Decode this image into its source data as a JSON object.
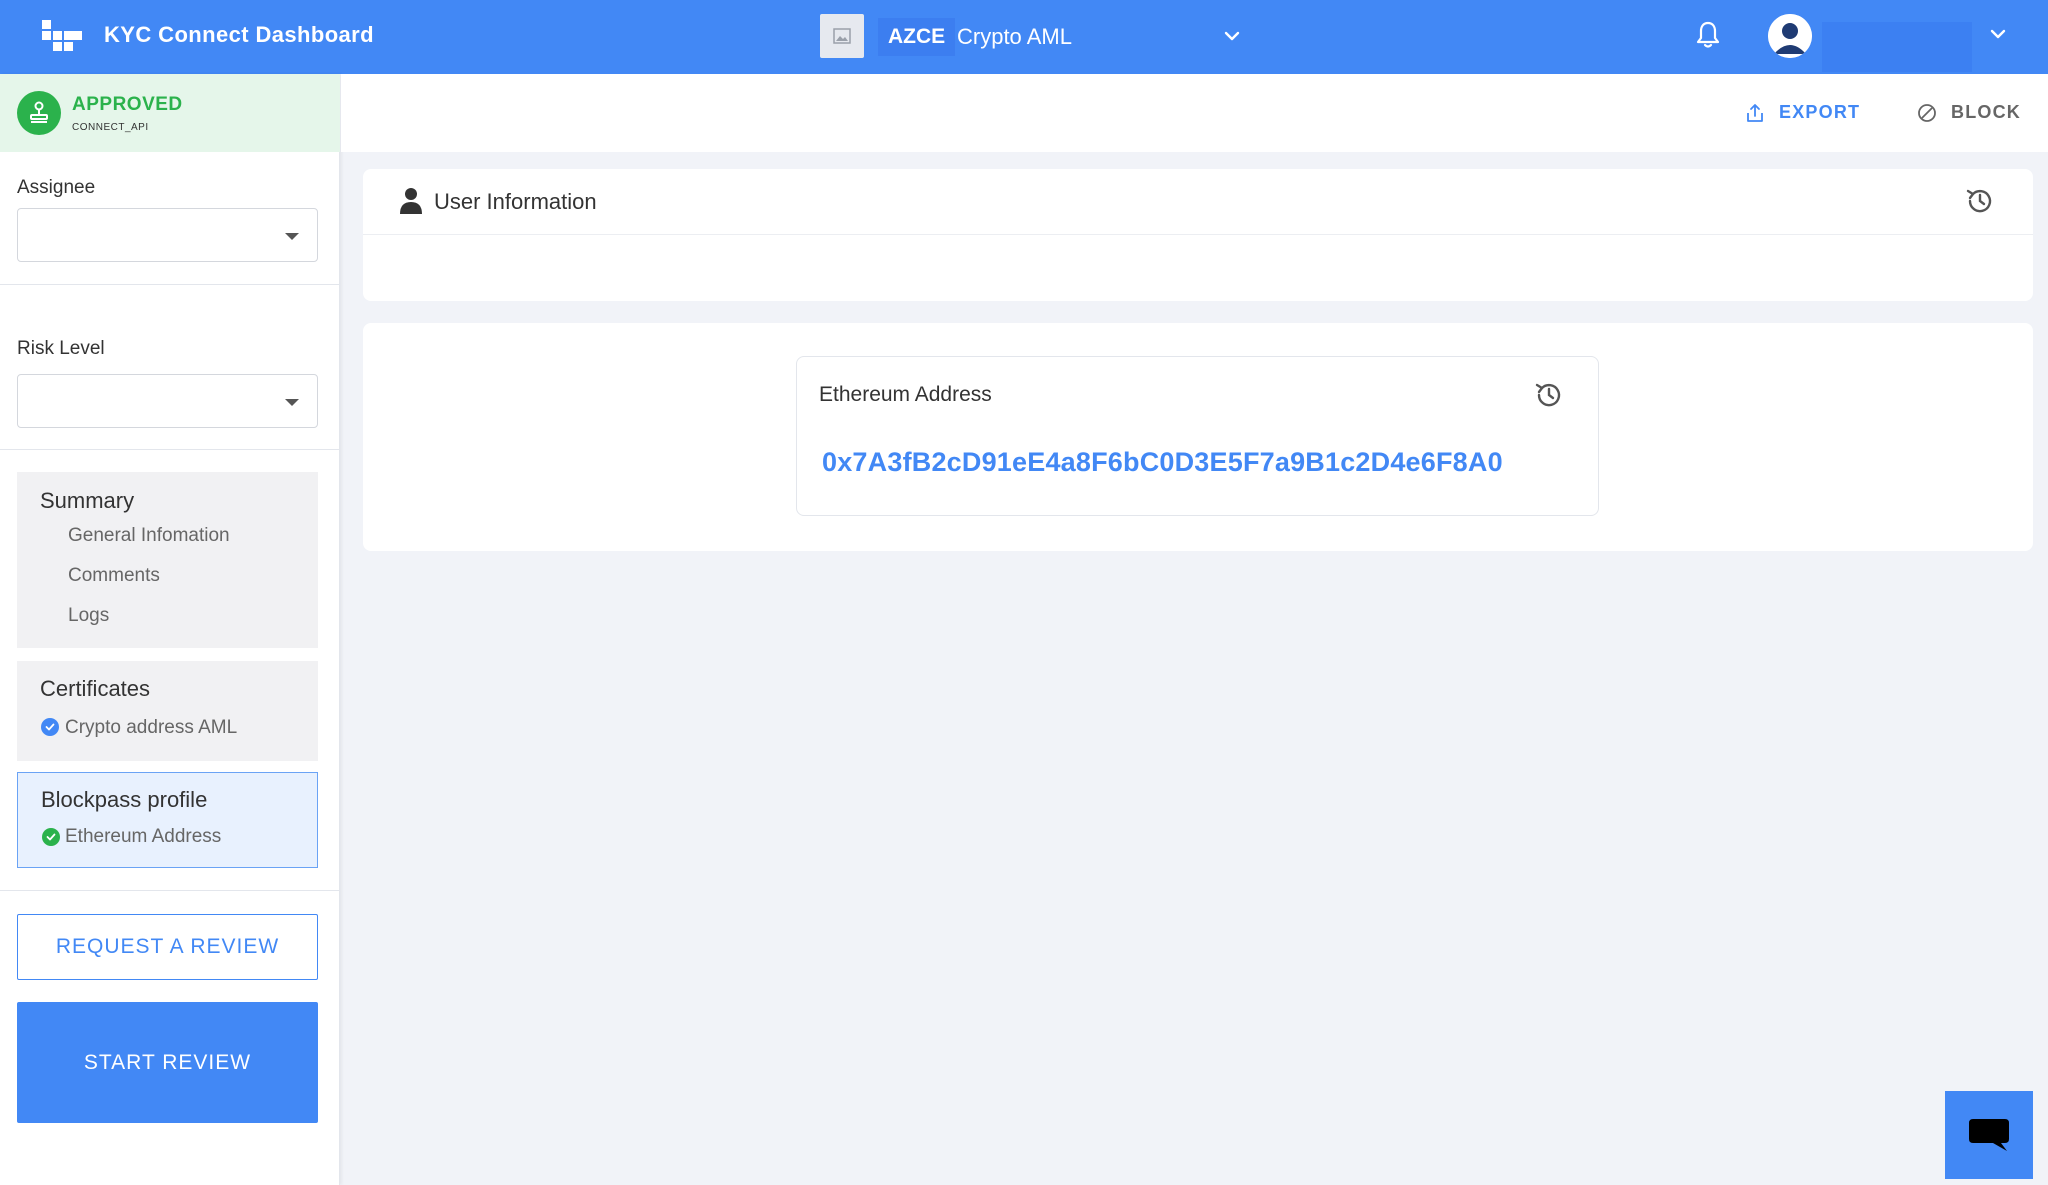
{
  "header": {
    "app_title": "KYC Connect Dashboard",
    "service": {
      "code": "AZCE",
      "name": "Crypto AML"
    },
    "icons": {
      "logo": "grid-logo-icon",
      "notification": "bell-icon",
      "avatar": "user-avatar-icon",
      "dropdown": "chevron-down-icon"
    }
  },
  "sidebar": {
    "status": {
      "label": "APPROVED",
      "source": "CONNECT_API",
      "color": "#2bb24c",
      "icon": "stamp-icon"
    },
    "assignee": {
      "label": "Assignee",
      "value": ""
    },
    "risk_level": {
      "label": "Risk Level",
      "value": ""
    },
    "summary": {
      "title": "Summary",
      "items": [
        "General Infomation",
        "Comments",
        "Logs"
      ]
    },
    "certificates": {
      "title": "Certificates",
      "items": [
        {
          "label": "Crypto address AML",
          "status": "verified",
          "color": "#4288f5"
        }
      ]
    },
    "blockpass_profile": {
      "title": "Blockpass profile",
      "items": [
        {
          "label": "Ethereum Address",
          "status": "approved",
          "color": "#2bb24c"
        }
      ]
    },
    "request_review_label": "REQUEST A REVIEW",
    "start_review_label": "START REVIEW"
  },
  "actions": {
    "export_label": "EXPORT",
    "block_label": "BLOCK"
  },
  "user_information": {
    "title": "User Information",
    "icon": "person-icon"
  },
  "ethereum_address": {
    "label": "Ethereum Address",
    "value": "0x7A3fB2cD91eE4a8F6bC0D3E5F7a9B1c2D4e6F8A0"
  },
  "colors": {
    "primary": "#4288f5",
    "success": "#2bb24c",
    "background": "#f1f3f8"
  }
}
